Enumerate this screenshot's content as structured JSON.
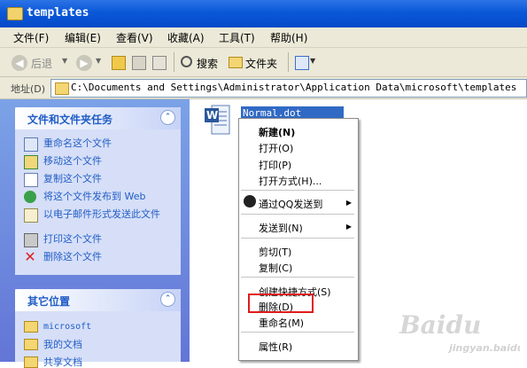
{
  "window": {
    "title": "templates"
  },
  "menu": [
    {
      "label": "文件(F)"
    },
    {
      "label": "编辑(E)"
    },
    {
      "label": "查看(V)"
    },
    {
      "label": "收藏(A)"
    },
    {
      "label": "工具(T)"
    },
    {
      "label": "帮助(H)"
    }
  ],
  "toolbar": {
    "back_label": "后退",
    "search_label": "搜索",
    "folders_label": "文件夹"
  },
  "address": {
    "label": "地址(D)",
    "path": "C:\\Documents and Settings\\Administrator\\Application Data\\microsoft\\templates"
  },
  "tasks_panel": {
    "title": "文件和文件夹任务",
    "items": [
      {
        "label": "重命名这个文件",
        "icon": "rename-icon"
      },
      {
        "label": "移动这个文件",
        "icon": "move-icon"
      },
      {
        "label": "复制这个文件",
        "icon": "copy-icon"
      },
      {
        "label": "将这个文件发布到 Web",
        "icon": "publish-web-icon"
      },
      {
        "label": "以电子邮件形式发送此文件",
        "icon": "email-icon"
      },
      {
        "label": "打印这个文件",
        "icon": "printer-icon"
      },
      {
        "label": "删除这个文件",
        "icon": "delete-x-icon"
      }
    ]
  },
  "places_panel": {
    "title": "其它位置",
    "items": [
      {
        "label": "microsoft"
      },
      {
        "label": "我的文档"
      },
      {
        "label": "共享文档"
      }
    ]
  },
  "file": {
    "name": "Normal.dot"
  },
  "context_menu": {
    "items": [
      {
        "label": "新建(N)"
      },
      {
        "label": "打开(O)"
      },
      {
        "label": "打印(P)"
      },
      {
        "label": "打开方式(H)..."
      },
      {
        "label": "通过QQ发送到"
      },
      {
        "label": "发送到(N)"
      },
      {
        "label": "剪切(T)"
      },
      {
        "label": "复制(C)"
      },
      {
        "label": "创建快捷方式(S)"
      },
      {
        "label": "删除(D)"
      },
      {
        "label": "重命名(M)"
      },
      {
        "label": "属性(R)"
      }
    ]
  },
  "colors": {
    "titlebar": "#0a58d8",
    "highlight_box": "#e01b1b",
    "selection": "#316ac5",
    "link": "#215dc6"
  }
}
